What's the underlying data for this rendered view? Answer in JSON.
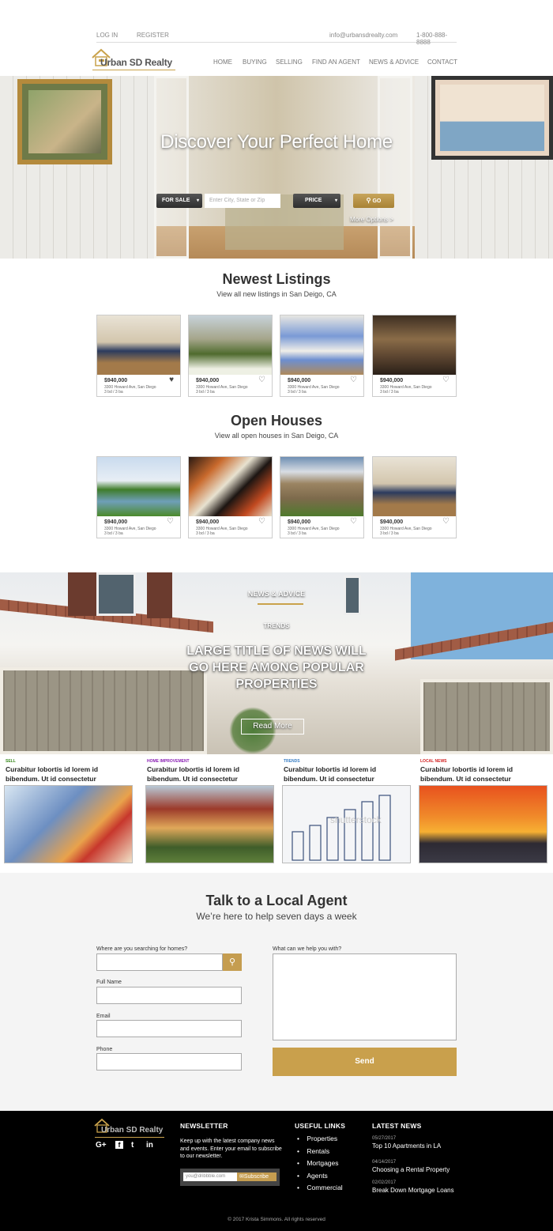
{
  "topbar": {
    "login": "LOG IN",
    "register": "REGISTER",
    "email": "info@urbansdrealty.com",
    "phone": "1-800-888-8888"
  },
  "brand": {
    "name": "Urban SD Realty",
    "accent": "#c9a24b"
  },
  "nav": {
    "items": [
      "HOME",
      "BUYING",
      "SELLING",
      "FIND AN AGENT",
      "NEWS & ADVICE",
      "CONTACT"
    ]
  },
  "hero": {
    "title": "Discover Your Perfect Home",
    "sale_select": "FOR SALE",
    "search_placeholder": "Enter City, State or Zip",
    "price_select": "PRICE",
    "go_label": "GO",
    "more_options": "More Options >"
  },
  "newest": {
    "title": "Newest Listings",
    "subtitle": "View all new listings in San Deigo, CA",
    "cards": [
      {
        "price": "$940,000",
        "address": "3300 Howard Ave, San Diego",
        "beds": "3 bd / 3 ba"
      },
      {
        "price": "$940,000",
        "address": "3300 Howard Ave, San Diego",
        "beds": "3 bd / 3 ba"
      },
      {
        "price": "$940,000",
        "address": "3300 Howard Ave, San Diego",
        "beds": "3 bd / 3 ba"
      },
      {
        "price": "$940,000",
        "address": "3300 Howard Ave, San Diego",
        "beds": "3 bd / 3 ba"
      }
    ]
  },
  "open": {
    "title": "Open Houses",
    "subtitle": "View all open houses in San Deigo, CA",
    "cards": [
      {
        "price": "$940,000",
        "address": "3300 Howard Ave, San Diego",
        "beds": "3 bd / 3 ba"
      },
      {
        "price": "$940,000",
        "address": "3300 Howard Ave, San Diego",
        "beds": "3 bd / 3 ba"
      },
      {
        "price": "$940,000",
        "address": "3300 Howard Ave, San Diego",
        "beds": "3 bd / 3 ba"
      },
      {
        "price": "$940,000",
        "address": "3300 Howard Ave, San Diego",
        "beds": "3 bd / 3 ba"
      }
    ]
  },
  "news": {
    "label": "NEWS & ADVICE",
    "category": "TRENDS",
    "headline": "LARGE TITLE OF NEWS WILL GO HERE AMONG POPULAR PROPERTIES",
    "read_more": "Read More",
    "articles": [
      {
        "category": "SELL",
        "color": "#3a8a1e",
        "title": "Curabitur lobortis id lorem id bibendum. Ut id consectetur"
      },
      {
        "category": "HOME IMPROVEMENT",
        "color": "#8a1eb3",
        "title": "Curabitur lobortis id lorem id bibendum. Ut id consectetur"
      },
      {
        "category": "TRENDS",
        "color": "#3a7fc4",
        "title": "Curabitur lobortis id lorem id bibendum. Ut id consectetur"
      },
      {
        "category": "LOCAL NEWS",
        "color": "#d21f1f",
        "title": "Curabitur lobortis id lorem id bibendum. Ut id consectetur"
      }
    ],
    "watermark": "shutterstock"
  },
  "agent": {
    "title": "Talk to a Local Agent",
    "subtitle": "We’re here to help seven days a week",
    "where_label": "Where are you searching for homes?",
    "name_label": "Full Name",
    "email_label": "Email",
    "phone_label": "Phone",
    "help_label": "What can we help you with?",
    "send_label": "Send"
  },
  "footer": {
    "newsletter_title": "NEWSLETTER",
    "newsletter_text": "Keep up with the latest company news and events. Enter your email to subscribe to our newsletter.",
    "email_placeholder": "you@dribbble.com",
    "subscribe_label": "Subscribe",
    "links_title": "USEFUL LINKS",
    "links": [
      "Properties",
      "Rentals",
      "Mortgages",
      "Agents",
      "Commercial"
    ],
    "latest_title": "LATEST NEWS",
    "latest": [
      {
        "date": "05/27/2017",
        "title": "Top 10 Apartments in LA"
      },
      {
        "date": "04/14/2017",
        "title": "Choosing a Rental Property"
      },
      {
        "date": "02/02/2017",
        "title": "Break Down Mortgage Loans"
      }
    ],
    "copyright": "© 2017 Krista Simmons. All rights reserved",
    "social": [
      "G+",
      "f",
      "t",
      "in"
    ]
  }
}
